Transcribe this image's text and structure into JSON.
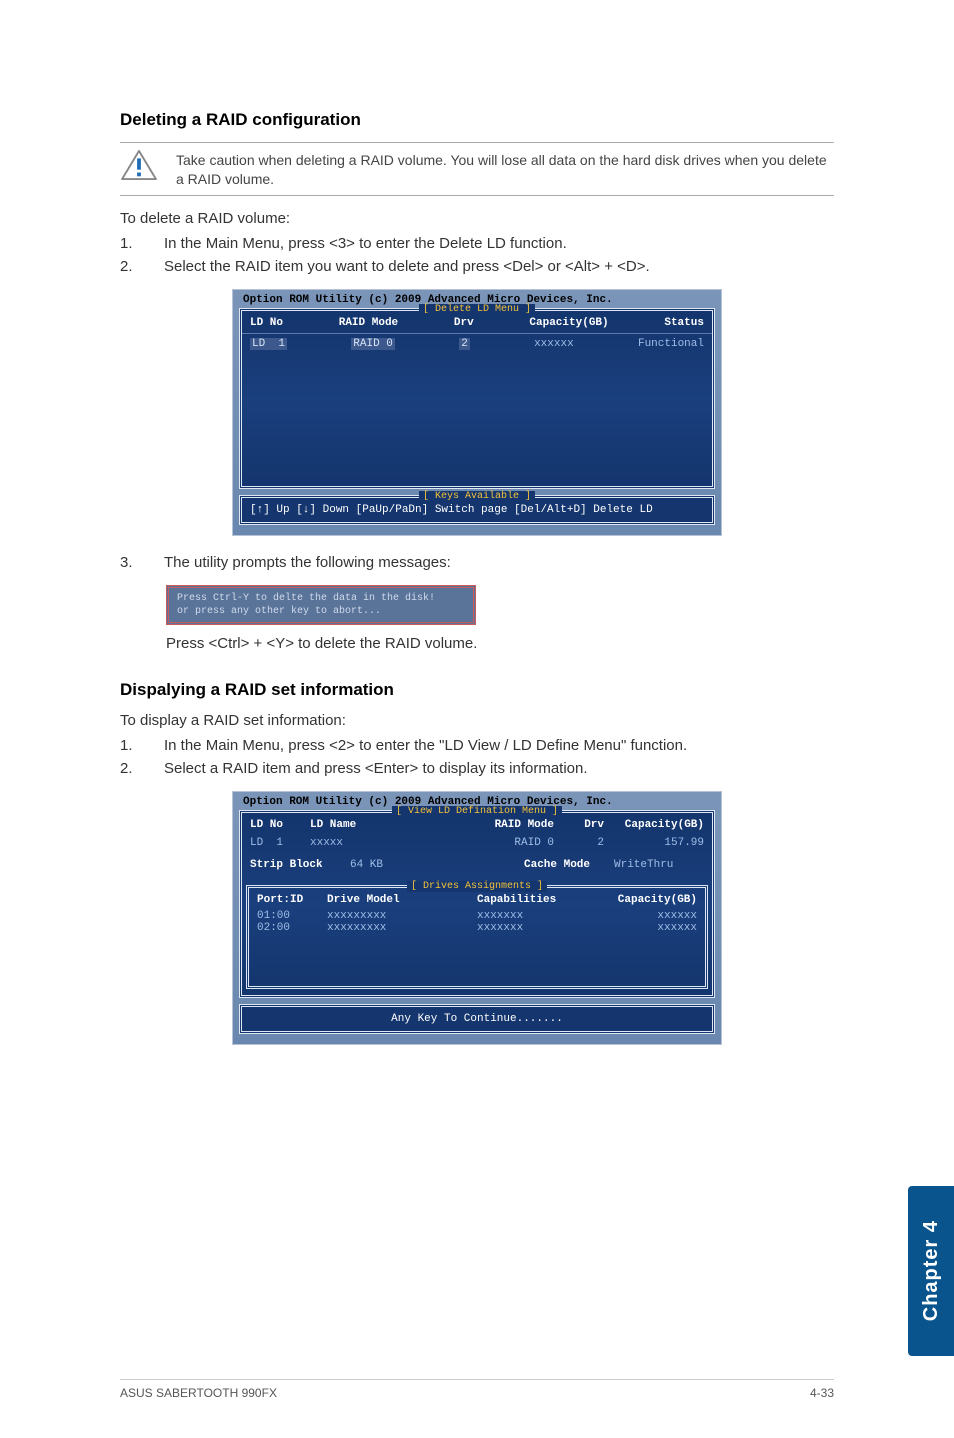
{
  "section1": {
    "heading": "Deleting a RAID configuration",
    "caution": "Take caution when deleting a RAID volume. You will lose all data on the hard disk drives when you delete a RAID volume.",
    "intro": "To delete a RAID volume:",
    "steps": [
      {
        "n": "1.",
        "t": "In the Main Menu, press <3> to enter the Delete LD function."
      },
      {
        "n": "2.",
        "t": "Select the RAID item you want to delete and press <Del> or <Alt> + <D>."
      }
    ],
    "post_step": {
      "n": "3.",
      "t": "The utility prompts the following messages:"
    },
    "confirm_lines": [
      "Press Ctrl-Y to delte the data in the disk!",
      "or press any other key to abort..."
    ],
    "final": "Press <Ctrl> + <Y> to delete the RAID volume."
  },
  "bios1": {
    "rom": "Option ROM Utility (c) 2009 Advanced Micro Devices, Inc.",
    "panel_label": "[ Delete LD Menu ]",
    "headers": {
      "c1": "LD No",
      "c2": "RAID Mode",
      "c3": "Drv",
      "c4": "Capacity(GB)",
      "c5": "Status"
    },
    "row": {
      "c1": "LD  1",
      "c2": "RAID 0",
      "c3": "2",
      "c4": "xxxxxx",
      "c5": "Functional"
    },
    "keys_label": "[ Keys Available ]",
    "keys_text": "[↑] Up  [↓] Down  [PaUp/PaDn] Switch page  [Del/Alt+D] Delete LD"
  },
  "section2": {
    "heading": "Dispalying a RAID set information",
    "intro": "To display a RAID set information:",
    "steps": [
      {
        "n": "1.",
        "t": "In the Main Menu, press <2> to enter the \"LD View / LD Define Menu\" function."
      },
      {
        "n": "2.",
        "t": "Select a RAID item and press <Enter> to display its information."
      }
    ]
  },
  "bios2": {
    "rom": "Option ROM Utility (c) 2009 Advanced Micro Devices, Inc.",
    "panel_label": "[ View LD Defination Menu ]",
    "r1": {
      "a": "LD No",
      "b": "LD Name",
      "c": "RAID Mode",
      "d": "Drv",
      "e": "Capacity(GB)"
    },
    "r2": {
      "a": "LD  1",
      "b": "xxxxx",
      "c": "RAID 0",
      "d": "2",
      "e": "157.99"
    },
    "r3": {
      "a": "Strip Block",
      "b": "64 KB",
      "c": "Cache Mode",
      "d": "WriteThru"
    },
    "drives_label": "[ Drives Assignments ]",
    "dh": {
      "a": "Port:ID",
      "b": "Drive Model",
      "c": "Capabilities",
      "d": "Capacity(GB)"
    },
    "d1": {
      "a": "01:00",
      "b": "xxxxxxxxx",
      "c": "xxxxxxx",
      "d": "xxxxxx"
    },
    "d2": {
      "a": "02:00",
      "b": "xxxxxxxxx",
      "c": "xxxxxxx",
      "d": "xxxxxx"
    },
    "continue": "Any Key To Continue......."
  },
  "sidetab": "Chapter 4",
  "footer": {
    "left": "ASUS SABERTOOTH 990FX",
    "right": "4-33"
  }
}
